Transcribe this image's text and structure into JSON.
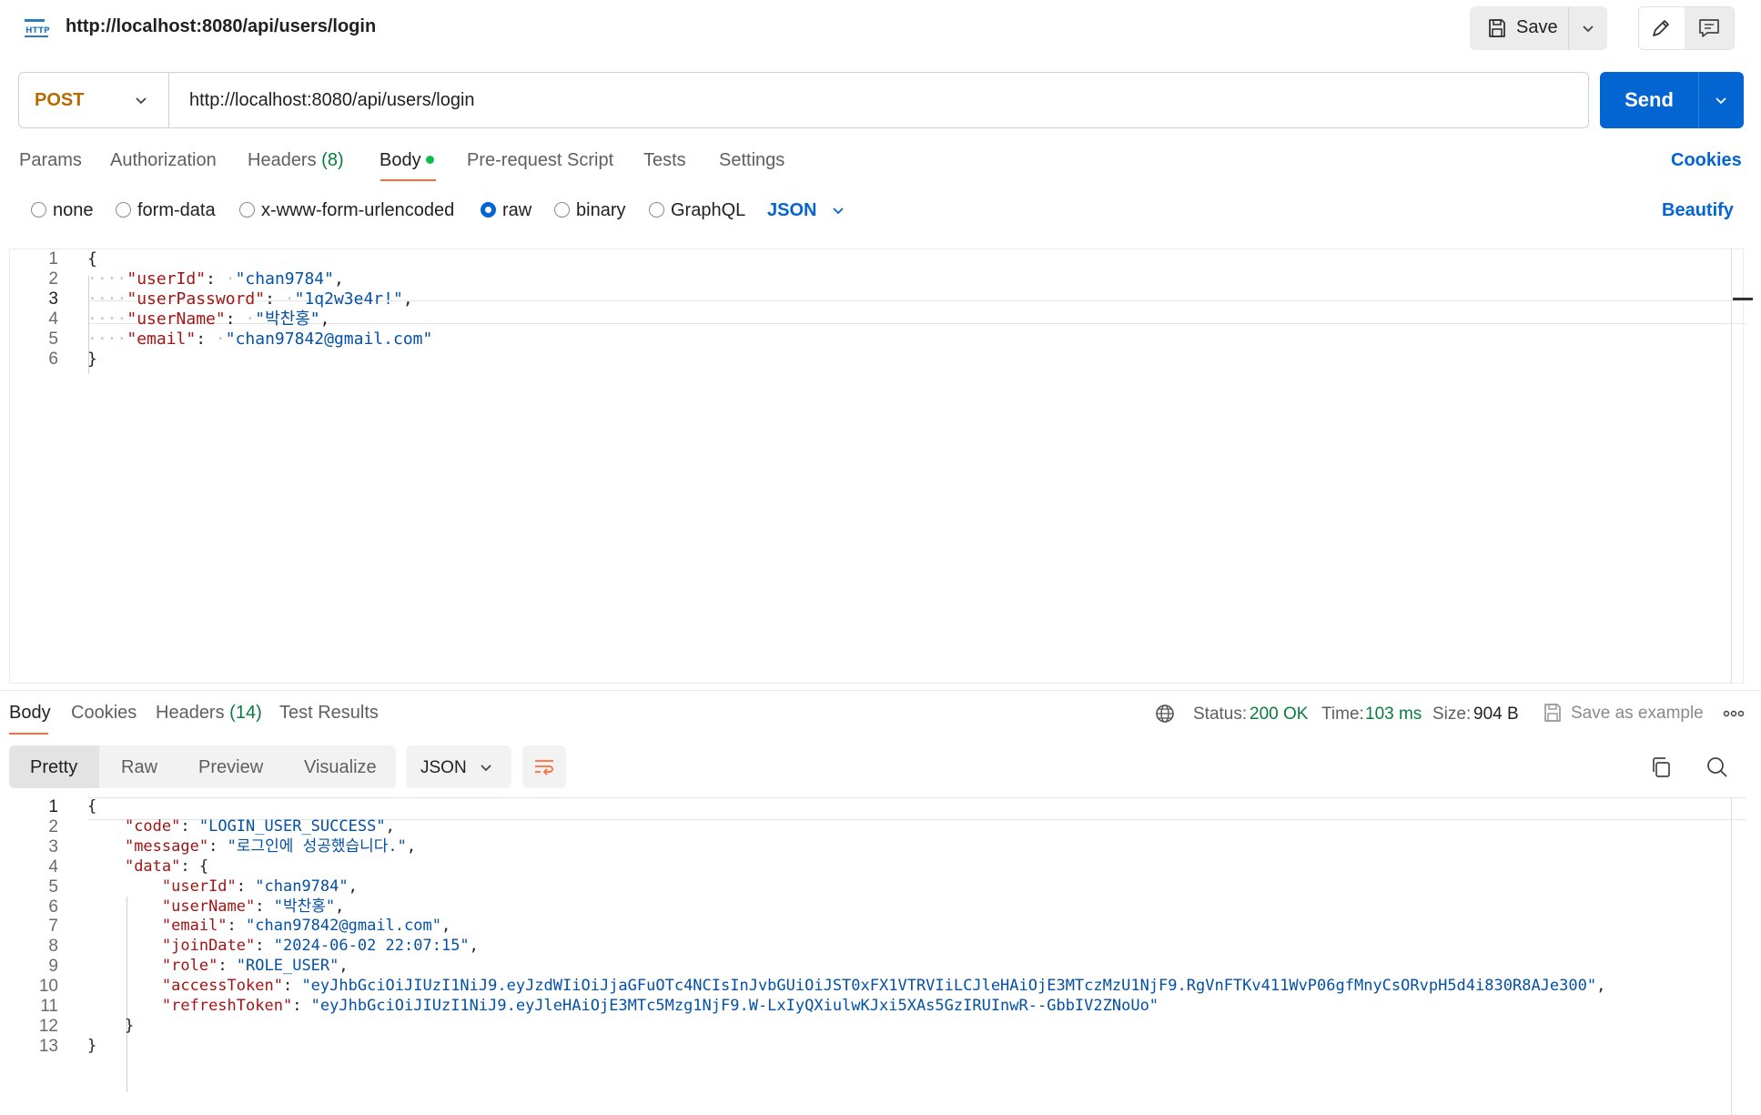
{
  "header": {
    "request_title": "http://localhost:8080/api/users/login",
    "save_label": "Save",
    "http_icon_label": "HTTP"
  },
  "request": {
    "method": "POST",
    "url": "http://localhost:8080/api/users/login",
    "send_label": "Send",
    "tabs": [
      {
        "label": "Params"
      },
      {
        "label": "Authorization"
      },
      {
        "label": "Headers",
        "count": "(8)"
      },
      {
        "label": "Body"
      },
      {
        "label": "Pre-request Script"
      },
      {
        "label": "Tests"
      },
      {
        "label": "Settings"
      }
    ],
    "cookies_label": "Cookies",
    "body_types": [
      "none",
      "form-data",
      "x-www-form-urlencoded",
      "raw",
      "binary",
      "GraphQL"
    ],
    "selected_body_type": "raw",
    "format": "JSON",
    "beautify_label": "Beautify",
    "code_lines": [
      {
        "num": "1",
        "tokens": [
          [
            "p",
            "{"
          ]
        ]
      },
      {
        "num": "2",
        "tokens": [
          [
            "ws",
            "····"
          ],
          [
            "k",
            "\"userId\""
          ],
          [
            "p",
            ": "
          ],
          [
            "ws",
            "·"
          ],
          [
            "s",
            "\"chan9784\""
          ],
          [
            "p",
            ","
          ]
        ]
      },
      {
        "num": "3",
        "tokens": [
          [
            "ws",
            "····"
          ],
          [
            "k",
            "\"userPassword\""
          ],
          [
            "p",
            ": "
          ],
          [
            "ws",
            "·"
          ],
          [
            "s",
            "\"1q2w3e4r!\""
          ],
          [
            "p",
            ","
          ]
        ]
      },
      {
        "num": "4",
        "tokens": [
          [
            "ws",
            "····"
          ],
          [
            "k",
            "\"userName\""
          ],
          [
            "p",
            ": "
          ],
          [
            "ws",
            "·"
          ],
          [
            "s",
            "\"박찬홍\""
          ],
          [
            "p",
            ","
          ]
        ]
      },
      {
        "num": "5",
        "tokens": [
          [
            "ws",
            "····"
          ],
          [
            "k",
            "\"email\""
          ],
          [
            "p",
            ": "
          ],
          [
            "ws",
            "·"
          ],
          [
            "s",
            "\"chan97842@gmail.com\""
          ]
        ]
      },
      {
        "num": "6",
        "tokens": [
          [
            "p",
            "}"
          ]
        ]
      }
    ]
  },
  "response": {
    "tabs": [
      {
        "label": "Body"
      },
      {
        "label": "Cookies"
      },
      {
        "label": "Headers",
        "count": "(14)"
      },
      {
        "label": "Test Results"
      }
    ],
    "status_label": "Status:",
    "status_value": "200 OK",
    "time_label": "Time:",
    "time_value": "103 ms",
    "size_label": "Size:",
    "size_value": "904 B",
    "save_example_label": "Save as example",
    "views": [
      "Pretty",
      "Raw",
      "Preview",
      "Visualize"
    ],
    "format": "JSON",
    "code_lines": [
      {
        "num": "1",
        "tokens": [
          [
            "p",
            "{"
          ]
        ]
      },
      {
        "num": "2",
        "tokens": [
          [
            "p",
            "    "
          ],
          [
            "k",
            "\"code\""
          ],
          [
            "p",
            ": "
          ],
          [
            "s",
            "\"LOGIN_USER_SUCCESS\""
          ],
          [
            "p",
            ","
          ]
        ]
      },
      {
        "num": "3",
        "tokens": [
          [
            "p",
            "    "
          ],
          [
            "k",
            "\"message\""
          ],
          [
            "p",
            ": "
          ],
          [
            "s",
            "\"로그인에 성공했습니다.\""
          ],
          [
            "p",
            ","
          ]
        ]
      },
      {
        "num": "4",
        "tokens": [
          [
            "p",
            "    "
          ],
          [
            "k",
            "\"data\""
          ],
          [
            "p",
            ": {"
          ]
        ]
      },
      {
        "num": "5",
        "tokens": [
          [
            "p",
            "        "
          ],
          [
            "k",
            "\"userId\""
          ],
          [
            "p",
            ": "
          ],
          [
            "s",
            "\"chan9784\""
          ],
          [
            "p",
            ","
          ]
        ]
      },
      {
        "num": "6",
        "tokens": [
          [
            "p",
            "        "
          ],
          [
            "k",
            "\"userName\""
          ],
          [
            "p",
            ": "
          ],
          [
            "s",
            "\"박찬홍\""
          ],
          [
            "p",
            ","
          ]
        ]
      },
      {
        "num": "7",
        "tokens": [
          [
            "p",
            "        "
          ],
          [
            "k",
            "\"email\""
          ],
          [
            "p",
            ": "
          ],
          [
            "s",
            "\"chan97842@gmail.com\""
          ],
          [
            "p",
            ","
          ]
        ]
      },
      {
        "num": "8",
        "tokens": [
          [
            "p",
            "        "
          ],
          [
            "k",
            "\"joinDate\""
          ],
          [
            "p",
            ": "
          ],
          [
            "s",
            "\"2024-06-02 22:07:15\""
          ],
          [
            "p",
            ","
          ]
        ]
      },
      {
        "num": "9",
        "tokens": [
          [
            "p",
            "        "
          ],
          [
            "k",
            "\"role\""
          ],
          [
            "p",
            ": "
          ],
          [
            "s",
            "\"ROLE_USER\""
          ],
          [
            "p",
            ","
          ]
        ]
      },
      {
        "num": "10",
        "tokens": [
          [
            "p",
            "        "
          ],
          [
            "k",
            "\"accessToken\""
          ],
          [
            "p",
            ": "
          ],
          [
            "s",
            "\"eyJhbGciOiJIUzI1NiJ9.eyJzdWIiOiJjaGFuOTc4NCIsInJvbGUiOiJST0xFX1VTRVIiLCJleHAiOjE3MTczMzU1NjF9.RgVnFTKv411WvP06gfMnyCsORvpH5d4i830R8AJe300\""
          ],
          [
            "p",
            ","
          ]
        ]
      },
      {
        "num": "11",
        "tokens": [
          [
            "p",
            "        "
          ],
          [
            "k",
            "\"refreshToken\""
          ],
          [
            "p",
            ": "
          ],
          [
            "s",
            "\"eyJhbGciOiJIUzI1NiJ9.eyJleHAiOjE3MTc5Mzg1NjF9.W-LxIyQXiulwKJxi5XAs5GzIRUInwR--GbbIV2ZNoUo\""
          ]
        ]
      },
      {
        "num": "12",
        "tokens": [
          [
            "p",
            "    }"
          ]
        ]
      },
      {
        "num": "13",
        "tokens": [
          [
            "p",
            "}"
          ]
        ]
      }
    ]
  },
  "colors": {
    "accent": "#0265d2",
    "method": "#b56b00",
    "status_ok": "#0a7c3d",
    "active_tab_underline": "#ff6c37",
    "json_key": "#a31515",
    "json_string": "#0451a5"
  }
}
